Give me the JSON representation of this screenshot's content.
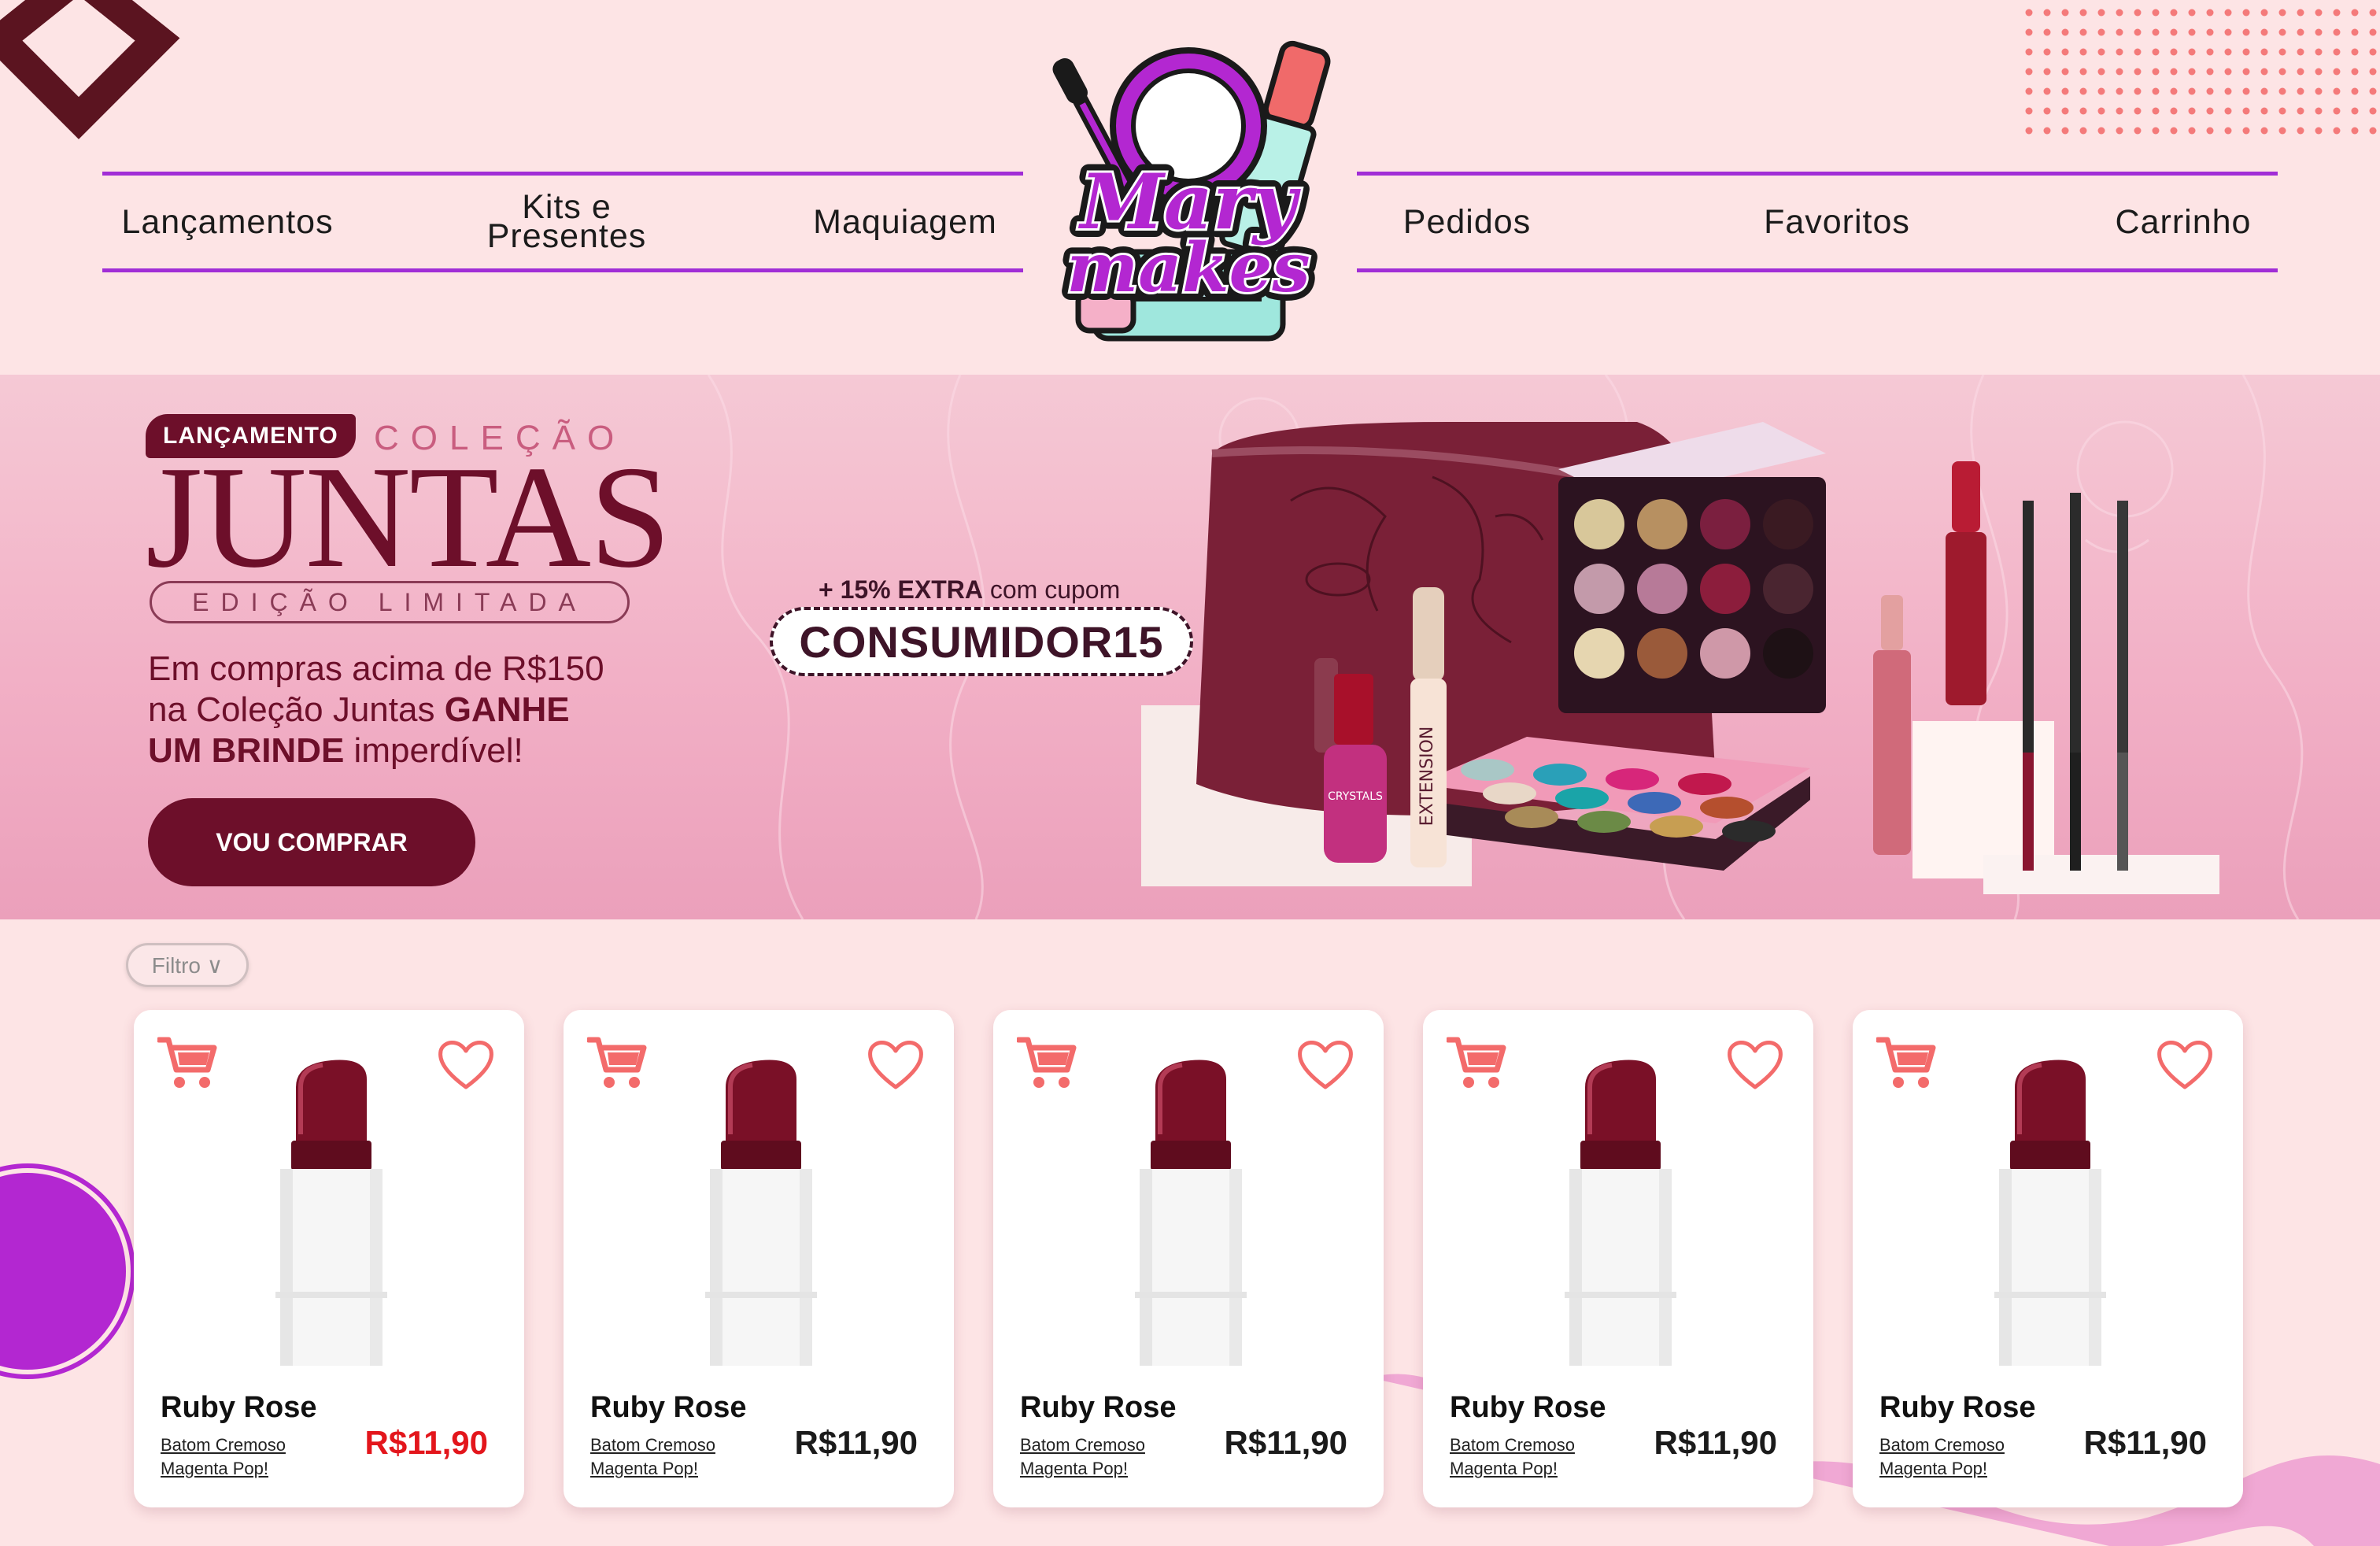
{
  "brand": {
    "logo_line1": "Mary",
    "logo_line2": "makes"
  },
  "nav": {
    "left": [
      "Lançamentos",
      "Kits e\nPresentes",
      "Maquiagem"
    ],
    "right": [
      "Pedidos",
      "Favoritos",
      "Carrinho"
    ]
  },
  "hero": {
    "badge": "LANÇAMENTO",
    "collection_word": "COLEÇÃO",
    "title": "JUNTAS",
    "subtitle": "EDIÇÃO LIMITADA",
    "promo_line1": "Em compras acima de R$150",
    "promo_line2_a": "na Coleção Juntas ",
    "promo_line2_b": "GANHE",
    "promo_line3_a": "UM BRINDE",
    "promo_line3_b": " imperdível!",
    "cta": "VOU COMPRAR",
    "extra_a": "+ 15% EXTRA",
    "extra_b": " com cupom",
    "coupon": "CONSUMIDOR15",
    "art_labels": {
      "nail_polish": "CRYSTALS",
      "mascara": "EXTENSION"
    }
  },
  "filter": {
    "label": "Filtro ∨"
  },
  "products": [
    {
      "brand": "Ruby Rose",
      "desc_line1": "Batom Cremoso",
      "desc_line2": "Magenta Pop!",
      "price": "R$11,90",
      "sale": true
    },
    {
      "brand": "Ruby Rose",
      "desc_line1": "Batom Cremoso",
      "desc_line2": "Magenta Pop!",
      "price": "R$11,90",
      "sale": false
    },
    {
      "brand": "Ruby Rose",
      "desc_line1": "Batom Cremoso",
      "desc_line2": "Magenta Pop!",
      "price": "R$11,90",
      "sale": false
    },
    {
      "brand": "Ruby Rose",
      "desc_line1": "Batom Cremoso",
      "desc_line2": "Magenta Pop!",
      "price": "R$11,90",
      "sale": false
    },
    {
      "brand": "Ruby Rose",
      "desc_line1": "Batom Cremoso",
      "desc_line2": "Magenta Pop!",
      "price": "R$11,90",
      "sale": false
    }
  ],
  "icons": {
    "cart": "cart-icon",
    "favorite": "heart-icon"
  },
  "colors": {
    "accent_purple": "#a12dd6",
    "wine": "#6d0f2a",
    "coral": "#f36b6b",
    "sale_red": "#e3161c",
    "page_bg": "#fde4e5"
  }
}
